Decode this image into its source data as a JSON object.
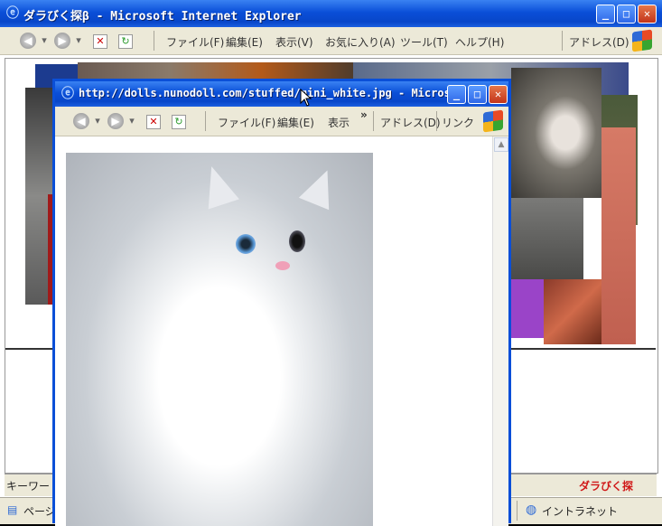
{
  "main_window": {
    "title": "ダラびく探β - Microsoft Internet Explorer",
    "menu": [
      "ファイル(F)",
      "編集(E)",
      "表示(V)",
      "お気に入り(A)",
      "ツール(T)",
      "ヘルプ(H)"
    ],
    "address_label": "アドレス(D)",
    "keyword_label": "キーワード",
    "status_left": "ページ",
    "status_zone": "イントラネット",
    "brand_logo": "ダラびく探"
  },
  "popup_window": {
    "title": "http://dolls.nunodoll.com/stuffed/mini_white.jpg - Microsof...",
    "menu": [
      "ファイル(F)",
      "編集(E)",
      "表示"
    ],
    "chevron": "»",
    "address_label": "アドレス(D)",
    "links_label": "リンク"
  },
  "icons": {
    "ie": "ie-icon",
    "back": "back-arrow-icon",
    "forward": "forward-arrow-icon",
    "stop": "stop-icon",
    "refresh": "refresh-icon",
    "windows": "windows-logo-icon",
    "minimize": "minimize-icon",
    "maximize": "maximize-icon",
    "close": "close-icon",
    "scroll_up": "scroll-up-arrow-icon",
    "cursor": "mouse-cursor-icon"
  },
  "colors": {
    "titlebar": "#0a4fd8",
    "toolbar": "#ece9d8",
    "close_button": "#c2341a"
  }
}
